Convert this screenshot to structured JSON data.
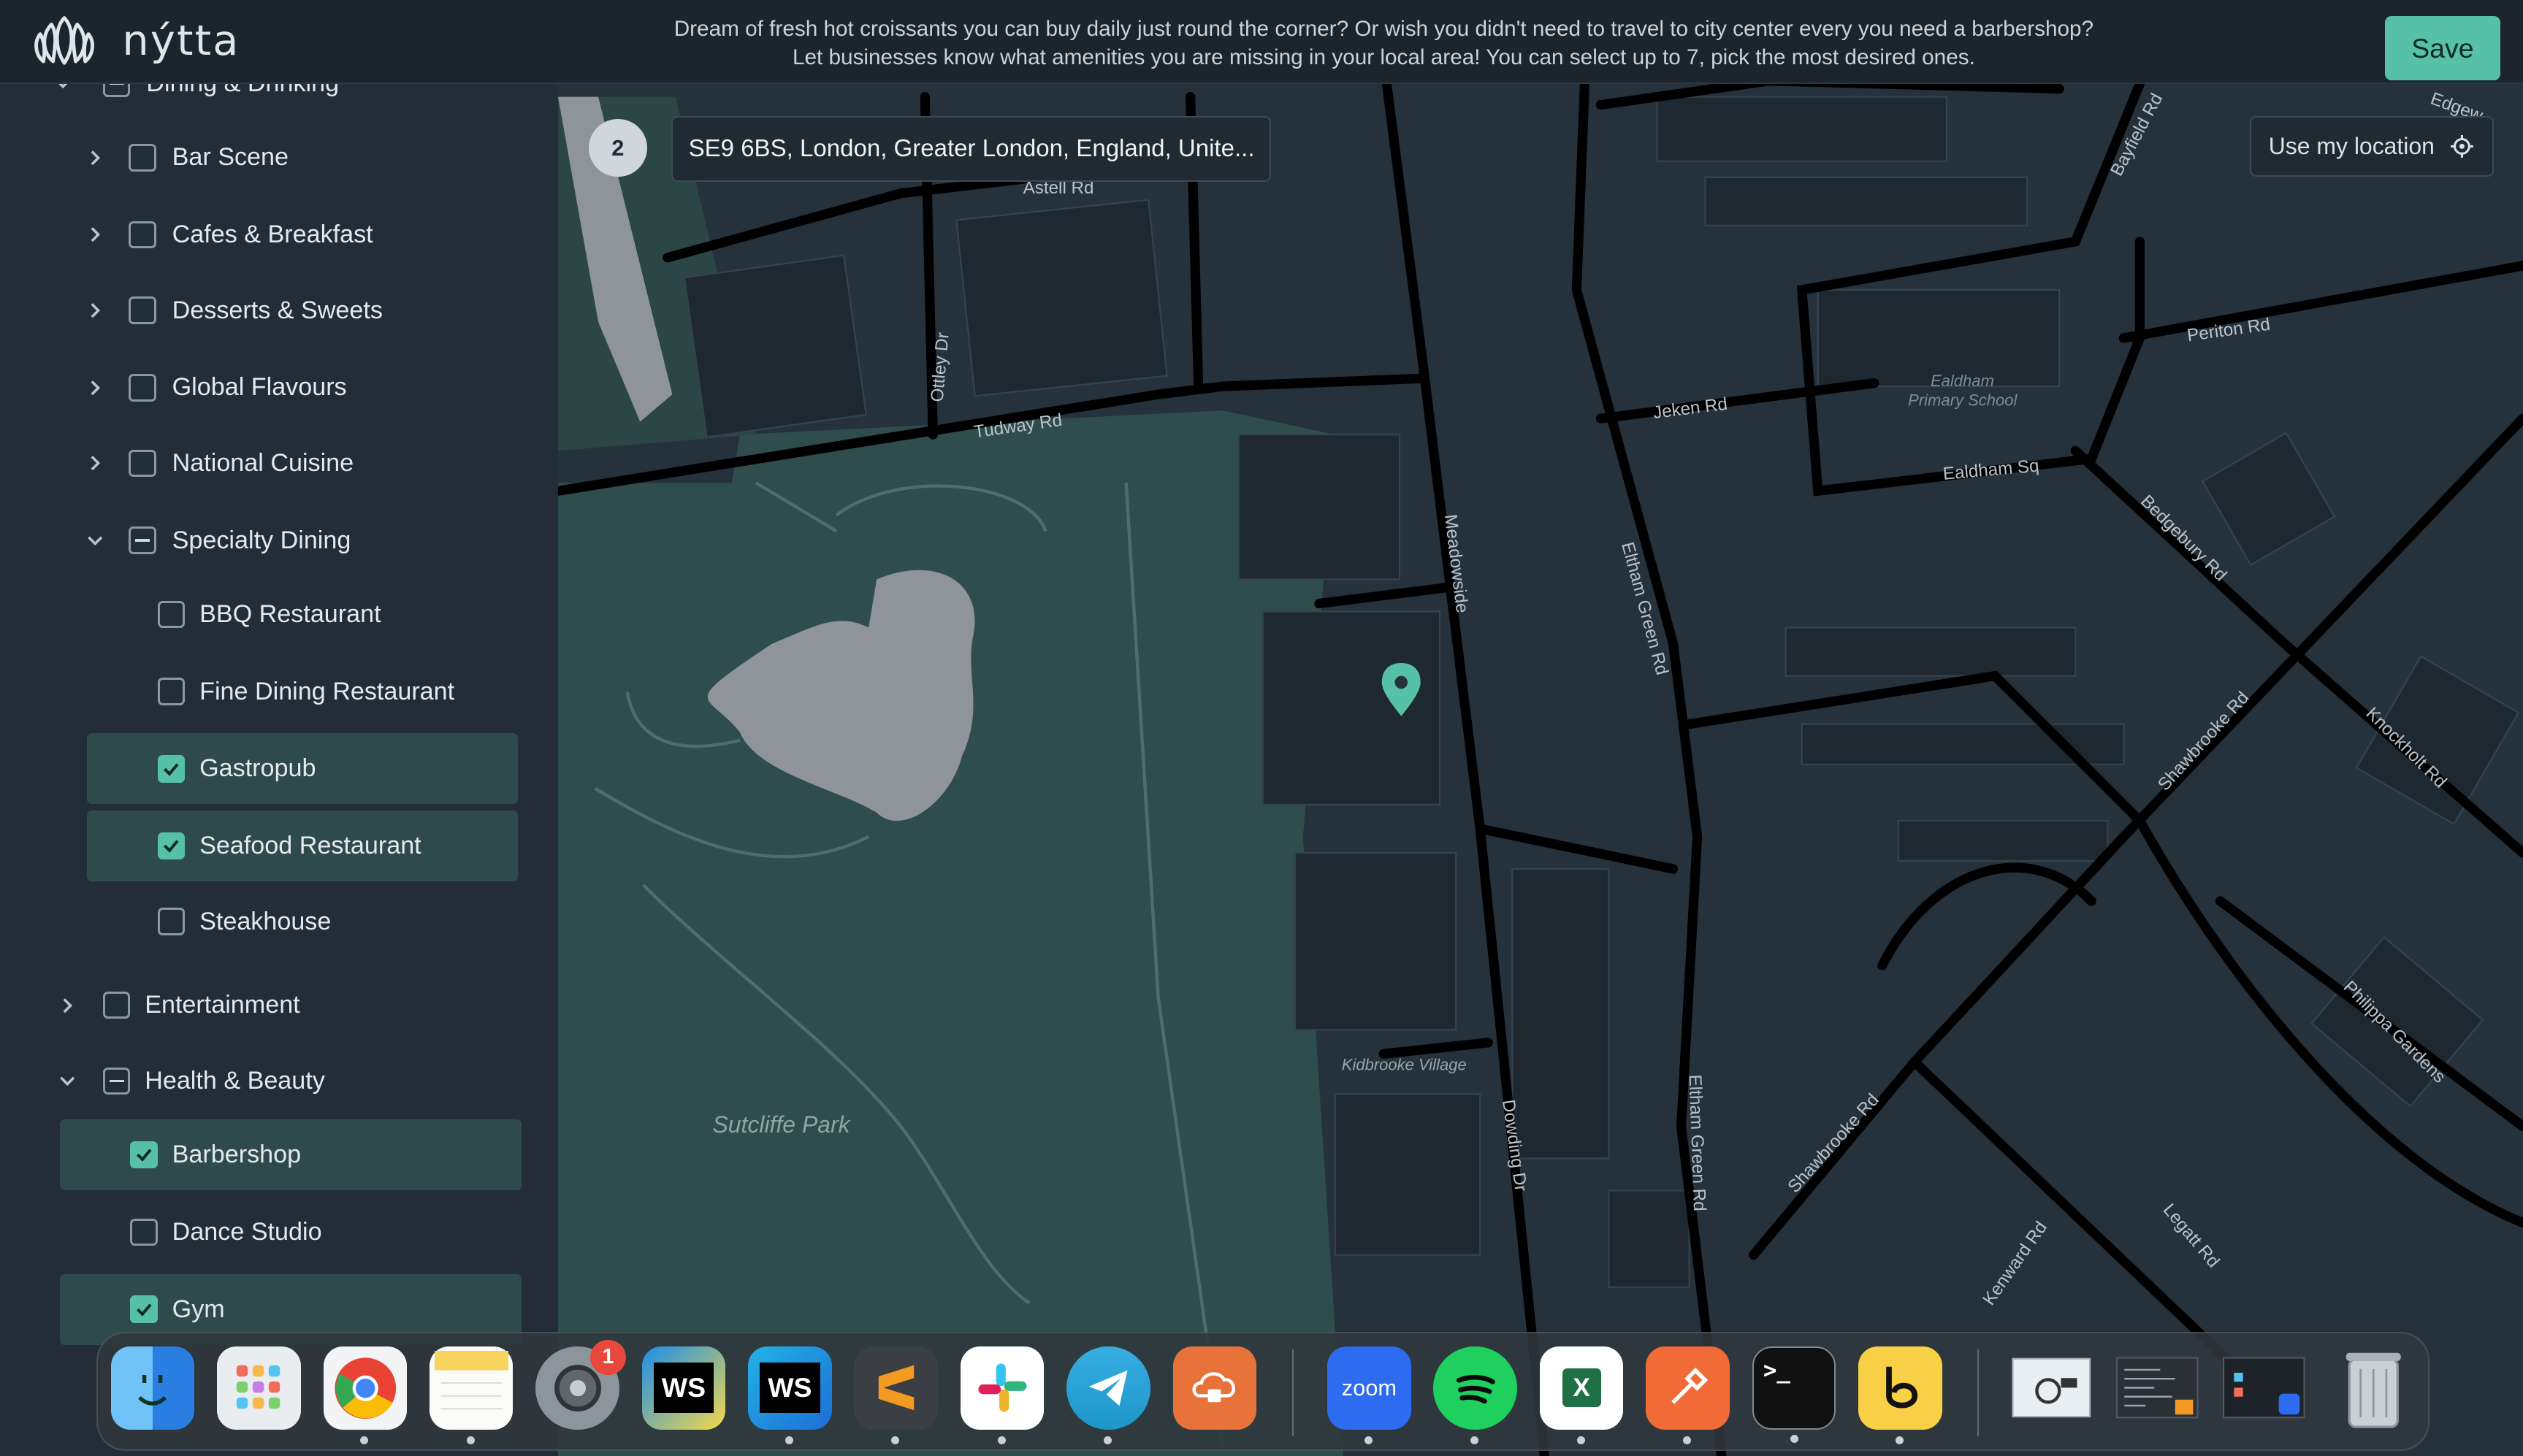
{
  "app": {
    "logo_text": "nýtta"
  },
  "banner": {
    "line1": "Dream of fresh hot croissants you can buy daily just round the corner? Or wish you didn't need to travel to city center every you need a barbershop?",
    "line2": "Let businesses know what amenities you are missing in your local area! You can select up to 7, pick the most desired ones."
  },
  "toolbar": {
    "save_label": "Save"
  },
  "sidebar": {
    "partial_top_label": "Dining & Drinking",
    "items": [
      {
        "label": "Bar Scene",
        "state": "unchecked",
        "expandable": true
      },
      {
        "label": "Cafes & Breakfast",
        "state": "unchecked",
        "expandable": true
      },
      {
        "label": "Desserts & Sweets",
        "state": "unchecked",
        "expandable": true
      },
      {
        "label": "Global Flavours",
        "state": "unchecked",
        "expandable": true
      },
      {
        "label": "National Cuisine",
        "state": "unchecked",
        "expandable": true
      },
      {
        "label": "Specialty Dining",
        "state": "indeterminate",
        "expanded": true
      },
      {
        "label": "BBQ Restaurant",
        "state": "unchecked"
      },
      {
        "label": "Fine Dining Restaurant",
        "state": "unchecked"
      },
      {
        "label": "Gastropub",
        "state": "checked"
      },
      {
        "label": "Seafood Restaurant",
        "state": "checked"
      },
      {
        "label": "Steakhouse",
        "state": "unchecked"
      },
      {
        "label": "Entertainment",
        "state": "unchecked",
        "expandable": true
      },
      {
        "label": "Health & Beauty",
        "state": "indeterminate",
        "expanded": true
      },
      {
        "label": "Barbershop",
        "state": "checked"
      },
      {
        "label": "Dance Studio",
        "state": "unchecked"
      },
      {
        "label": "Gym",
        "state": "checked"
      }
    ]
  },
  "map": {
    "step_number": "2",
    "address_value": "SE9 6BS, London, Greater London, England, Unite...",
    "use_location_label": "Use my location",
    "labels": {
      "park": "Sutcliffe Park",
      "village": "Kidbrooke Village",
      "school": "Eldham Primary School",
      "school_line1": "Ealdham",
      "school_line2": "Primary School",
      "road_astell": "Astell Rd",
      "road_ottley": "Ottley Dr",
      "road_tudway": "Tudway Rd",
      "road_meadowside": "Meadowside",
      "road_eltham1": "Eltham Green Rd",
      "road_eltham2": "Eltham Green Rd",
      "road_jeken": "Jeken Rd",
      "road_ealdham": "Ealdham Sq",
      "road_periton": "Periton Rd",
      "road_bayfield": "Bayfield Rd",
      "road_bedgebury": "Bedgebury Rd",
      "road_shawbrooke1": "Shawbrooke Rd",
      "road_shawbrooke2": "Shawbrooke Rd",
      "road_knockholt": "Knockholt Rd",
      "road_philippa": "Philippa Gardens",
      "road_dowding": "Dowding Dr",
      "road_legatt": "Legatt Rd",
      "road_kenward": "Kenward Rd",
      "road_edgew": "Edgew"
    },
    "colors": {
      "accent": "#56c1a6",
      "park": "#2f4d4c",
      "water": "#8e949a",
      "road": "#000000"
    }
  },
  "dock": {
    "apps": [
      {
        "name": "finder-icon"
      },
      {
        "name": "launchpad-icon"
      },
      {
        "name": "chrome-icon"
      },
      {
        "name": "notes-icon"
      },
      {
        "name": "system-settings-icon",
        "badge": "1"
      },
      {
        "name": "webstorm-icon",
        "text": "WS"
      },
      {
        "name": "webstorm-alt-icon",
        "text": "WS"
      },
      {
        "name": "sublime-text-icon"
      },
      {
        "name": "slack-icon"
      },
      {
        "name": "telegram-icon"
      },
      {
        "name": "vpn-icon"
      },
      {
        "name": "zoom-icon",
        "text": "zoom"
      },
      {
        "name": "spotify-icon"
      },
      {
        "name": "excel-icon",
        "text": "X"
      },
      {
        "name": "postman-icon"
      },
      {
        "name": "terminal-icon",
        "text": ">_"
      },
      {
        "name": "beeper-icon"
      },
      {
        "name": "screenshot-stack-icon"
      },
      {
        "name": "code-window-icon"
      },
      {
        "name": "desktop-window-icon"
      },
      {
        "name": "trash-icon"
      }
    ]
  }
}
